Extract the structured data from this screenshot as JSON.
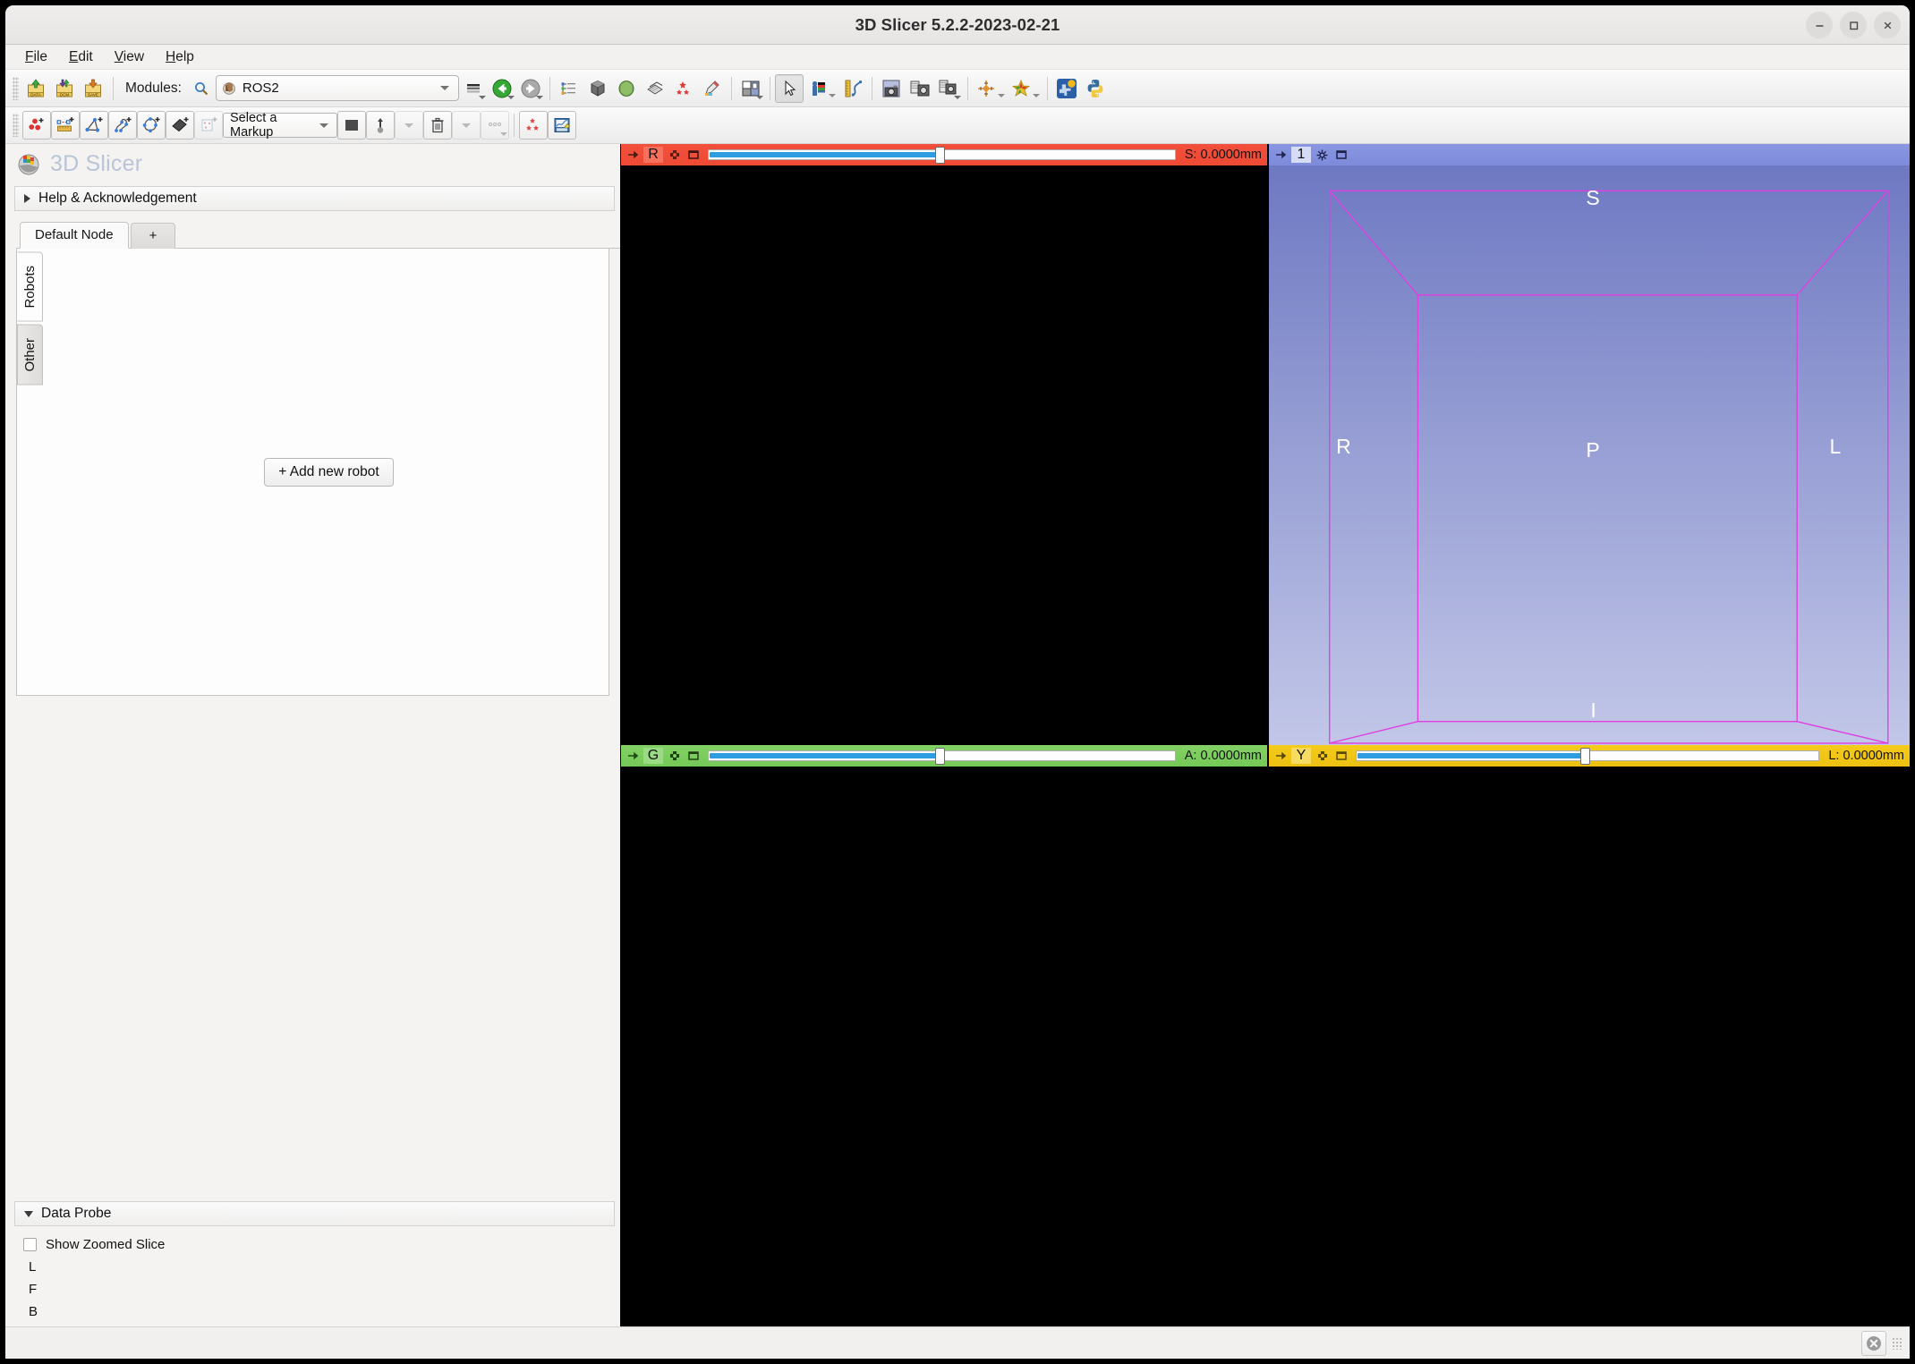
{
  "window": {
    "title": "3D Slicer 5.2.2-2023-02-21",
    "controls": {
      "minimize": "minimize-icon",
      "maximize": "maximize-icon",
      "close": "close-icon"
    }
  },
  "menubar": {
    "items": [
      {
        "label": "File",
        "mnemonic": "F",
        "rest": "ile"
      },
      {
        "label": "Edit",
        "mnemonic": "E",
        "rest": "dit"
      },
      {
        "label": "View",
        "mnemonic": "V",
        "rest": "iew"
      },
      {
        "label": "Help",
        "mnemonic": "H",
        "rest": "elp"
      }
    ]
  },
  "main_toolbar": {
    "modules_label": "Modules:",
    "search_icon": "magnifier-icon",
    "module_selected": "ROS2",
    "buttons": [
      {
        "name": "load-data-button",
        "icon": "load-data-icon"
      },
      {
        "name": "load-dicom-button",
        "icon": "dicom-icon"
      },
      {
        "name": "save-data-button",
        "icon": "save-icon"
      },
      {
        "name": "module-history-button",
        "icon": "history-icon"
      },
      {
        "name": "module-previous-button",
        "icon": "back-arrow-icon"
      },
      {
        "name": "module-next-button",
        "icon": "forward-arrow-icon"
      },
      {
        "name": "subject-hierarchy-button",
        "icon": "subject-hierarchy-icon"
      },
      {
        "name": "volume-rendering-button",
        "icon": "volume-cube-icon"
      },
      {
        "name": "models-button",
        "icon": "model-sphere-icon"
      },
      {
        "name": "volumes-button",
        "icon": "volumes-icon"
      },
      {
        "name": "fiducials-button",
        "icon": "markups-red-icon"
      },
      {
        "name": "editor-button",
        "icon": "segment-editor-icon"
      },
      {
        "name": "layout-button",
        "icon": "layout-grid-icon"
      },
      {
        "name": "mouse-mode-pointer-button",
        "icon": "mouse-pointer-icon"
      },
      {
        "name": "window-level-button",
        "icon": "window-level-icon"
      },
      {
        "name": "crosshair-button",
        "icon": "ruler-crosshair-icon"
      },
      {
        "name": "capture-screenshot-button",
        "icon": "camera-icon"
      },
      {
        "name": "screen-capture-button",
        "icon": "screen-capture-icon"
      },
      {
        "name": "scene-views-button",
        "icon": "scene-views-icon"
      },
      {
        "name": "markups-crosshair-button",
        "icon": "crosshair-star-icon"
      },
      {
        "name": "favorite-modules-button",
        "icon": "colorful-star-icon"
      },
      {
        "name": "extension-manager-button",
        "icon": "extension-puzzle-icon"
      },
      {
        "name": "python-console-button",
        "icon": "python-icon"
      }
    ]
  },
  "markups_toolbar": {
    "select_markup_placeholder": "Select a Markup",
    "buttons": [
      {
        "name": "create-point-list-button",
        "icon": "point-list-icon"
      },
      {
        "name": "create-line-button",
        "icon": "line-ruler-icon"
      },
      {
        "name": "create-angle-button",
        "icon": "angle-icon"
      },
      {
        "name": "create-open-curve-button",
        "icon": "open-curve-icon"
      },
      {
        "name": "create-closed-curve-button",
        "icon": "closed-curve-icon"
      },
      {
        "name": "create-plane-button",
        "icon": "plane-icon"
      },
      {
        "name": "create-roi-button",
        "icon": "roi-box-icon"
      },
      {
        "name": "markup-color-button",
        "icon": "color-swatch-icon"
      },
      {
        "name": "place-persistent-button",
        "icon": "place-arrow-icon"
      },
      {
        "name": "delete-markup-button",
        "icon": "trash-icon"
      },
      {
        "name": "more-options-button",
        "icon": "ellipsis-icon"
      },
      {
        "name": "markups-settings-button",
        "icon": "markups-red-icon"
      },
      {
        "name": "markups-module-button",
        "icon": "markups-edit-icon"
      }
    ]
  },
  "left_panel": {
    "brand": "3D Slicer",
    "brand_icon": "slicer-logo-icon",
    "help_section": "Help & Acknowledgement",
    "node_tabs": [
      {
        "label": "Default Node",
        "active": true
      },
      {
        "label": "+",
        "active": false
      }
    ],
    "vertical_tabs": [
      {
        "label": "Robots",
        "active": true
      },
      {
        "label": "Other",
        "active": false
      }
    ],
    "add_robot_button": "+ Add new robot"
  },
  "data_probe": {
    "title": "Data Probe",
    "show_zoomed_slice": "Show Zoomed Slice",
    "show_zoomed_slice_checked": false,
    "lines": [
      "L",
      "F",
      "B"
    ]
  },
  "views": {
    "red": {
      "letter": "R",
      "offset": "S: 0.0000mm",
      "color": "#ee4a36",
      "slider_percent": 50
    },
    "green": {
      "letter": "G",
      "offset": "A: 0.0000mm",
      "color": "#75c957",
      "slider_percent": 50
    },
    "yellow": {
      "letter": "Y",
      "offset": "L: 0.0000mm",
      "color": "#edc111",
      "slider_percent": 50
    },
    "threeD": {
      "letter": "1",
      "color": "#7d8bdb",
      "orientation_labels": {
        "superior": "S",
        "inferior": "I",
        "right": "R",
        "left": "L",
        "posterior": "P"
      },
      "box_color": "#e03fe0"
    }
  },
  "statusbar": {
    "error_icon": "error-circle-x-icon"
  }
}
